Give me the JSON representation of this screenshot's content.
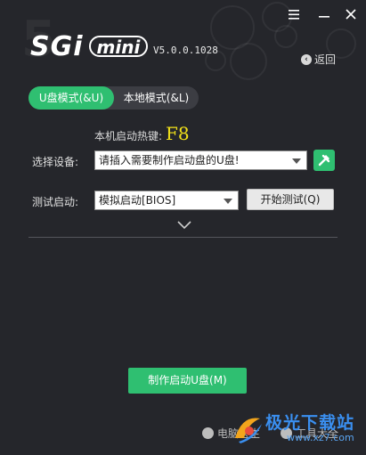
{
  "window": {
    "menu_icon": "menu-icon",
    "minimize_icon": "minimize-icon",
    "close_icon": "close-icon"
  },
  "header": {
    "logo_main": "SGi",
    "logo_badge": "mini",
    "version": "V5.0.0.1028",
    "back_label": "返回",
    "back_icon": "back-arrow-icon"
  },
  "tabs": [
    {
      "label": "U盘模式(&U)",
      "active": true
    },
    {
      "label": "本地模式(&L)",
      "active": false
    }
  ],
  "hotkey": {
    "label": "本机启动热键:",
    "value": "F8"
  },
  "device": {
    "label": "选择设备:",
    "value": "请插入需要制作启动盘的U盘!",
    "action_icon": "refresh-tool-icon"
  },
  "test": {
    "label": "测试启动:",
    "value": "模拟启动[BIOS]",
    "button_label": "开始测试(Q)"
  },
  "expand_icon": "chevron-down-icon",
  "make_button_label": "制作启动U盘(M)",
  "footer": {
    "link1": "电脑医生",
    "link2": "工具大全"
  },
  "watermark": {
    "title": "极光下载站",
    "url": "www.xz7.com"
  },
  "colors": {
    "accent": "#2fbf71",
    "background": "#25262b",
    "hotkey": "#f2e11a",
    "watermark": "#3a8ff0"
  }
}
